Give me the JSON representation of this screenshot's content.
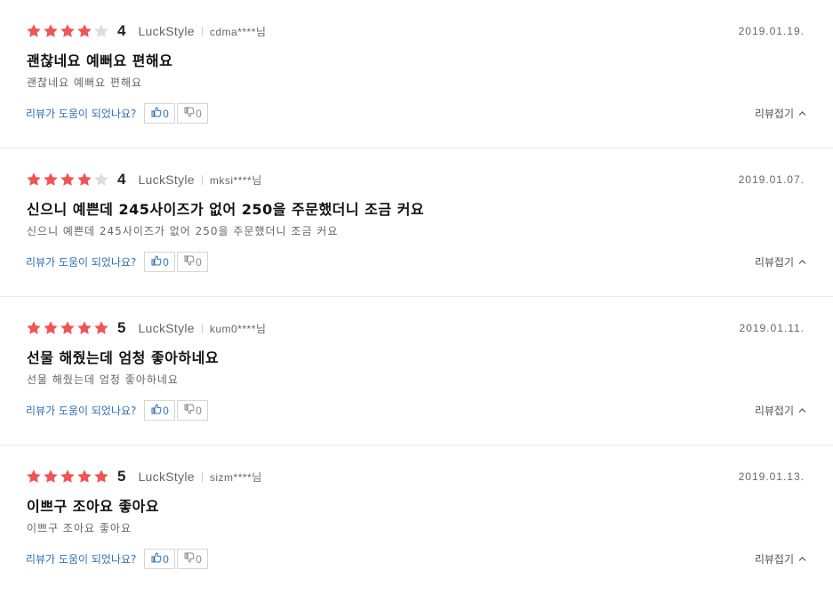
{
  "colors": {
    "star_on": "#f05454",
    "star_off": "#dddddd",
    "link": "#2f6fb4"
  },
  "helpful_question": "리뷰가 도움이 되었나요?",
  "fold_label": "리뷰접기",
  "icons": {
    "thumbs_up": "thumbs-up-icon",
    "thumbs_down": "thumbs-down-icon",
    "chevron": "chevron-up-icon",
    "star": "star-icon"
  },
  "reviews": [
    {
      "rating": 4,
      "score": "4",
      "seller": "LuckStyle",
      "user": "cdma****님",
      "date": "2019.01.19.",
      "title": "괜찮네요 예뻐요 편해요",
      "body": "괜찮네요 예뻐요 편해요",
      "likes": "0",
      "dislikes": "0"
    },
    {
      "rating": 4,
      "score": "4",
      "seller": "LuckStyle",
      "user": "mksi****님",
      "date": "2019.01.07.",
      "title": "신으니 예쁜데 245사이즈가 없어 250을 주문했더니 조금 커요",
      "body": "신으니 예쁜데 245사이즈가 없어 250을 주문했더니 조금 커요",
      "likes": "0",
      "dislikes": "0"
    },
    {
      "rating": 5,
      "score": "5",
      "seller": "LuckStyle",
      "user": "kum0****님",
      "date": "2019.01.11.",
      "title": "선물 해줬는데 엄청 좋아하네요",
      "body": "선물 해줬는데 엄청 좋아하네요",
      "likes": "0",
      "dislikes": "0"
    },
    {
      "rating": 5,
      "score": "5",
      "seller": "LuckStyle",
      "user": "sizm****님",
      "date": "2019.01.13.",
      "title": "이쁘구 조아요 좋아요",
      "body": "이쁘구 조아요 좋아요",
      "likes": "0",
      "dislikes": "0"
    }
  ]
}
